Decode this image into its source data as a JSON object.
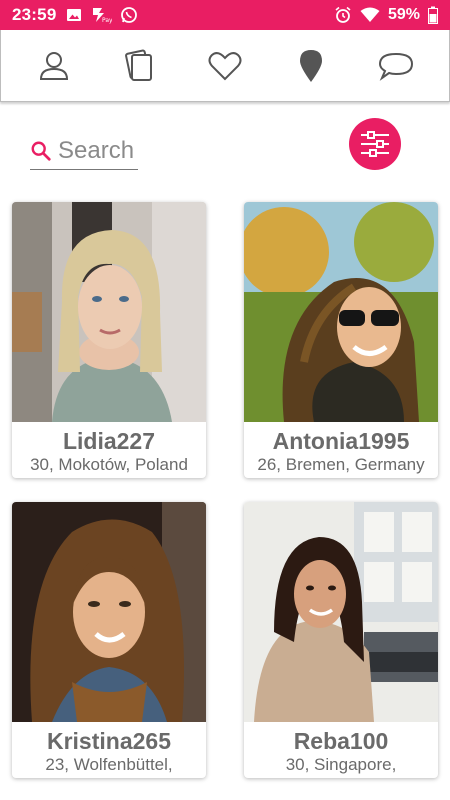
{
  "status_bar": {
    "time": "23:59",
    "battery": "59%",
    "left_icons": [
      "image-icon",
      "payment-icon",
      "whatsapp-icon"
    ],
    "right_icons": [
      "alarm-icon",
      "wifi-icon",
      "battery-icon"
    ]
  },
  "nav": {
    "items": [
      {
        "name": "profile",
        "icon": "person-icon"
      },
      {
        "name": "cards",
        "icon": "cards-icon"
      },
      {
        "name": "favorites",
        "icon": "heart-icon"
      },
      {
        "name": "nearby",
        "icon": "location-pin-icon"
      },
      {
        "name": "messages",
        "icon": "chat-bubble-icon"
      }
    ]
  },
  "search": {
    "placeholder": "Search"
  },
  "filter": {
    "icon": "sliders-icon"
  },
  "colors": {
    "accent": "#e91e63",
    "text_gray": "#6a6a6a",
    "icon_gray": "#555555"
  },
  "profiles": [
    {
      "name": "Lidia227",
      "location": "30, Mokotów, Poland"
    },
    {
      "name": "Antonia1995",
      "location": "26, Bremen, Germany"
    },
    {
      "name": "Kristina265",
      "location": "23, Wolfenbüttel,"
    },
    {
      "name": "Reba100",
      "location": "30, Singapore,"
    }
  ]
}
